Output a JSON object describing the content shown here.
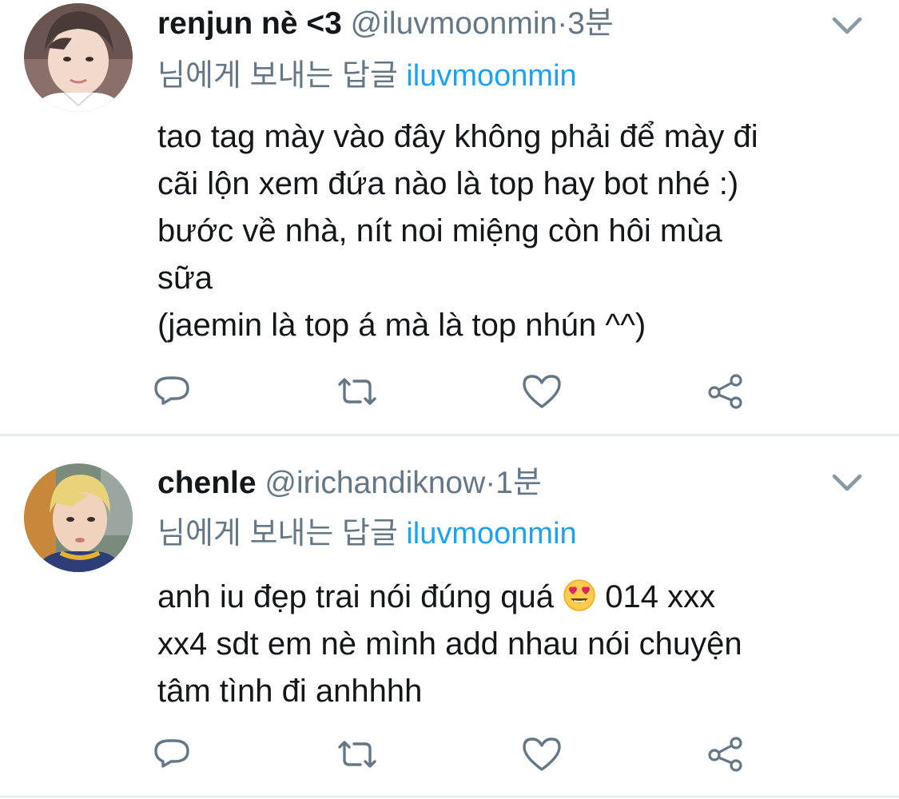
{
  "colors": {
    "text": "#14171a",
    "secondary": "#657786",
    "link": "#1da1f2",
    "icon": "#657786",
    "separator": "#e6ecf0"
  },
  "tweets": [
    {
      "display_name": "renjun nè <3",
      "handle": "@iluvmoonmin",
      "separator": "·",
      "time": "3분",
      "reply_prefix": "님에게 보내는 답글",
      "reply_user": "iluvmoonmin",
      "text_lines": [
        "tao tag mày vào đây không phải để mày đi",
        "cãi lộn xem đứa nào là top hay bot nhé :)",
        "bước về nhà, nít noi miệng còn hôi mùa",
        "sữa",
        "(jaemin là top á mà là top nhún ^^)"
      ],
      "icons": {
        "more": "chevron-down-icon",
        "reply": "reply-icon",
        "retweet": "retweet-icon",
        "like": "heart-icon",
        "share": "share-icon"
      }
    },
    {
      "display_name": "chenle",
      "handle": "@irichandiknow",
      "separator": "·",
      "time": "1분",
      "reply_prefix": "님에게 보내는 답글",
      "reply_user": "iluvmoonmin",
      "text_lines": [
        "anh iu đẹp trai nói đúng quá",
        "014 xxx",
        "xx4 sdt em nè mình add nhau nói chuyện",
        "tâm tình đi anhhhh"
      ],
      "emoji": "heart-eyes-emoji",
      "icons": {
        "more": "chevron-down-icon",
        "reply": "reply-icon",
        "retweet": "retweet-icon",
        "like": "heart-icon",
        "share": "share-icon"
      }
    }
  ]
}
